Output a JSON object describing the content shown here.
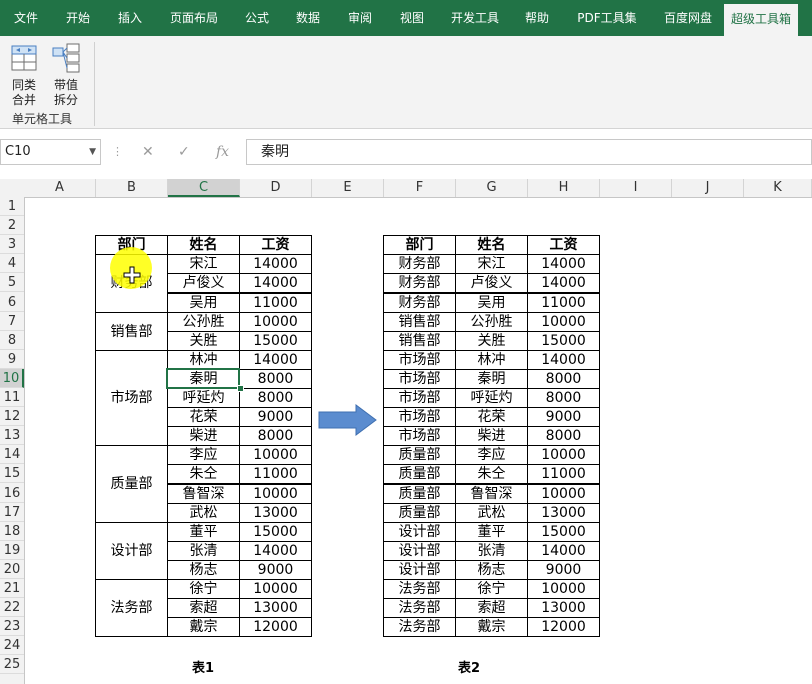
{
  "ribbon": {
    "tabs": [
      "文件",
      "开始",
      "插入",
      "页面布局",
      "公式",
      "数据",
      "审阅",
      "视图",
      "开发工具",
      "帮助",
      "PDF工具集",
      "百度网盘",
      "超级工具箱"
    ],
    "active_tab": "超级工具箱",
    "buttons": [
      {
        "line1": "同类",
        "line2": "合并"
      },
      {
        "line1": "带值",
        "line2": "拆分"
      }
    ],
    "group_label": "单元格工具"
  },
  "formula_bar": {
    "name_box": "C10",
    "fx_label": "fx",
    "formula": "秦明"
  },
  "columns": [
    "A",
    "B",
    "C",
    "D",
    "E",
    "F",
    "G",
    "H",
    "I",
    "J",
    "K"
  ],
  "selected_column": "C",
  "rows": [
    "1",
    "2",
    "3",
    "4",
    "5",
    "6",
    "7",
    "8",
    "9",
    "10",
    "11",
    "12",
    "13",
    "14",
    "15",
    "16",
    "17",
    "18",
    "19",
    "20",
    "21",
    "22",
    "23",
    "24",
    "25"
  ],
  "selected_row": "10",
  "table1": {
    "headers": [
      "部门",
      "姓名",
      "工资"
    ],
    "depts": [
      {
        "name": "财务部",
        "start": 4,
        "end": 6
      },
      {
        "name": "销售部",
        "start": 7,
        "end": 8
      },
      {
        "name": "市场部",
        "start": 9,
        "end": 13
      },
      {
        "name": "质量部",
        "start": 14,
        "end": 17
      },
      {
        "name": "设计部",
        "start": 18,
        "end": 20
      },
      {
        "name": "法务部",
        "start": 21,
        "end": 23
      }
    ],
    "names": [
      "宋江",
      "卢俊义",
      "吴用",
      "公孙胜",
      "关胜",
      "林冲",
      "秦明",
      "呼延灼",
      "花荣",
      "柴进",
      "李应",
      "朱仝",
      "鲁智深",
      "武松",
      "董平",
      "张清",
      "杨志",
      "徐宁",
      "索超",
      "戴宗"
    ],
    "salaries": [
      "14000",
      "14000",
      "11000",
      "10000",
      "15000",
      "14000",
      "8000",
      "8000",
      "9000",
      "8000",
      "10000",
      "11000",
      "10000",
      "13000",
      "15000",
      "14000",
      "9000",
      "10000",
      "13000",
      "12000"
    ],
    "caption": "表1"
  },
  "table2": {
    "headers": [
      "部门",
      "姓名",
      "工资"
    ],
    "depts": [
      "财务部",
      "财务部",
      "财务部",
      "销售部",
      "销售部",
      "市场部",
      "市场部",
      "市场部",
      "市场部",
      "市场部",
      "质量部",
      "质量部",
      "质量部",
      "质量部",
      "设计部",
      "设计部",
      "设计部",
      "法务部",
      "法务部",
      "法务部"
    ],
    "names": [
      "宋江",
      "卢俊义",
      "吴用",
      "公孙胜",
      "关胜",
      "林冲",
      "秦明",
      "呼延灼",
      "花荣",
      "柴进",
      "李应",
      "朱仝",
      "鲁智深",
      "武松",
      "董平",
      "张清",
      "杨志",
      "徐宁",
      "索超",
      "戴宗"
    ],
    "salaries": [
      "14000",
      "14000",
      "11000",
      "10000",
      "15000",
      "14000",
      "8000",
      "8000",
      "9000",
      "8000",
      "10000",
      "11000",
      "10000",
      "13000",
      "15000",
      "14000",
      "9000",
      "10000",
      "13000",
      "12000"
    ],
    "caption": "表2"
  },
  "colors": {
    "ribbon_green": "#217346",
    "arrow_blue": "#5b8ccf",
    "cursor_highlight": "#ffff00"
  }
}
